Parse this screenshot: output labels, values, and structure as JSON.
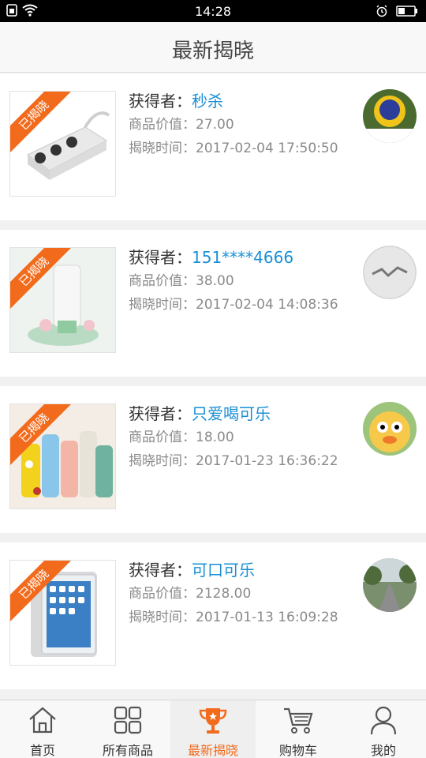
{
  "status_bar": {
    "time": "14:28"
  },
  "header": {
    "title": "最新揭晓"
  },
  "labels": {
    "ribbon": "已揭晓",
    "winner_prefix": "获得者：",
    "price_prefix": "商品价值：",
    "time_prefix": "揭晓时间："
  },
  "items": [
    {
      "winner": "秒杀",
      "price": "27.00",
      "time": "2017-02-04 17:50:50"
    },
    {
      "winner": "151****4666",
      "price": "38.00",
      "time": "2017-02-04 14:08:36"
    },
    {
      "winner": "只爱喝可乐",
      "price": "18.00",
      "time": "2017-01-23 16:36:22"
    },
    {
      "winner": "可口可乐",
      "price": "2128.00",
      "time": "2017-01-13 16:09:28"
    }
  ],
  "tabs": [
    {
      "label": "首页",
      "icon": "home-icon"
    },
    {
      "label": "所有商品",
      "icon": "grid-icon"
    },
    {
      "label": "最新揭晓",
      "icon": "trophy-icon"
    },
    {
      "label": "购物车",
      "icon": "cart-icon"
    },
    {
      "label": "我的",
      "icon": "person-icon"
    }
  ],
  "colors": {
    "accent": "#f26a1b",
    "link": "#1a8fd5"
  }
}
